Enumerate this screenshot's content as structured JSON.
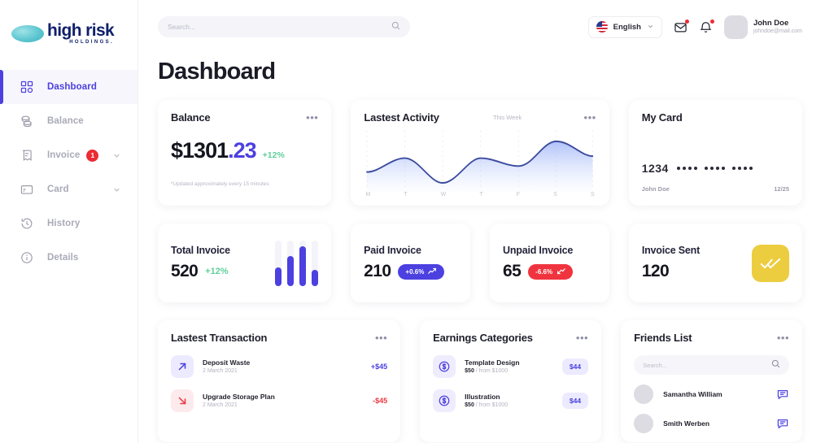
{
  "brand": {
    "name": "high risk",
    "tagline": "HOLDINGS."
  },
  "sidebar": {
    "items": [
      {
        "label": "Dashboard",
        "icon": "grid-icon",
        "active": true,
        "badge": null,
        "chevron": false
      },
      {
        "label": "Balance",
        "icon": "coins-icon",
        "active": false,
        "badge": null,
        "chevron": false
      },
      {
        "label": "Invoice",
        "icon": "invoice-icon",
        "active": false,
        "badge": "1",
        "chevron": true
      },
      {
        "label": "Card",
        "icon": "card-icon",
        "active": false,
        "badge": null,
        "chevron": true
      },
      {
        "label": "History",
        "icon": "history-icon",
        "active": false,
        "badge": null,
        "chevron": false
      },
      {
        "label": "Details",
        "icon": "info-icon",
        "active": false,
        "badge": null,
        "chevron": false
      }
    ]
  },
  "topbar": {
    "search_placeholder": "Search...",
    "language": "English",
    "flag": "us-flag-icon",
    "mail_icon": "envelope-icon",
    "bell_icon": "bell-icon",
    "user": {
      "name": "John Doe",
      "email": "johndoe@mail.com"
    }
  },
  "page": {
    "title": "Dashboard"
  },
  "balance_card": {
    "title": "Balance",
    "currency": "$ ",
    "amount_main": "1301",
    "amount_decimal": ".23",
    "percent": "+12%",
    "note": "*Updated approximately every 15 minutes"
  },
  "activity_card": {
    "title": "Lastest Activity",
    "period": "This Week",
    "days": [
      "M",
      "T",
      "W",
      "T",
      "F",
      "S",
      "S"
    ]
  },
  "my_card": {
    "title": "My Card",
    "number_prefix": "1234",
    "holder": "John Doe",
    "expiry": "12/25"
  },
  "stats": {
    "total_invoice": {
      "label": "Total Invoice",
      "value": "520",
      "percent": "+12%"
    },
    "paid_invoice": {
      "label": "Paid Invoice",
      "value": "210",
      "percent": "+0.6%",
      "trend": "up"
    },
    "unpaid_invoice": {
      "label": "Unpaid Invoice",
      "value": "65",
      "percent": "-6.6%",
      "trend": "down"
    },
    "invoice_sent": {
      "label": "Invoice Sent",
      "value": "120",
      "icon": "double-check-icon"
    }
  },
  "transactions": {
    "title": "Lastest Transaction",
    "items": [
      {
        "icon": "arrow-up-right-icon",
        "name": "Deposit Waste",
        "date": "2 March 2021",
        "amount": "+$45",
        "direction": "in"
      },
      {
        "icon": "arrow-down-right-icon",
        "name": "Upgrade Storage Plan",
        "date": "2 March 2021",
        "amount": "-$45",
        "direction": "out"
      }
    ]
  },
  "earnings": {
    "title": "Earnings Categories",
    "items": [
      {
        "icon": "dollar-coin-icon",
        "name": "Template Design",
        "price": "$50",
        "from": "/ from $1000",
        "amount": "$44"
      },
      {
        "icon": "dollar-coin-icon",
        "name": "Illustration",
        "price": "$50",
        "from": "/ from $1000",
        "amount": "$44"
      }
    ]
  },
  "friends": {
    "title": "Friends List",
    "search_placeholder": "Search...",
    "items": [
      {
        "name": "Samantha William",
        "icon": "chat-bubble-icon"
      },
      {
        "name": "Smith Werben",
        "icon": "chat-bubble-icon"
      }
    ]
  },
  "colors": {
    "accent": "#4C40E0",
    "green": "#5FCF9A",
    "red": "#F0343F",
    "yellow": "#EDCD40",
    "brand_navy": "#10206B",
    "brand_teal": "#5EC6D0"
  },
  "chart_data": {
    "type": "area",
    "title": "Lastest Activity",
    "x": [
      "M",
      "T",
      "W",
      "T",
      "F",
      "S",
      "S"
    ],
    "values": [
      22,
      42,
      10,
      40,
      32,
      64,
      38
    ],
    "ylim": [
      0,
      80
    ],
    "grid": true,
    "series": [
      {
        "name": "Activity",
        "values": [
          22,
          42,
          10,
          40,
          32,
          64,
          38
        ]
      }
    ]
  },
  "minibar_chart": {
    "type": "bar",
    "categories": [
      "1",
      "2",
      "3",
      "4"
    ],
    "values": [
      40,
      66,
      86,
      34
    ],
    "ylim": [
      0,
      100
    ]
  }
}
